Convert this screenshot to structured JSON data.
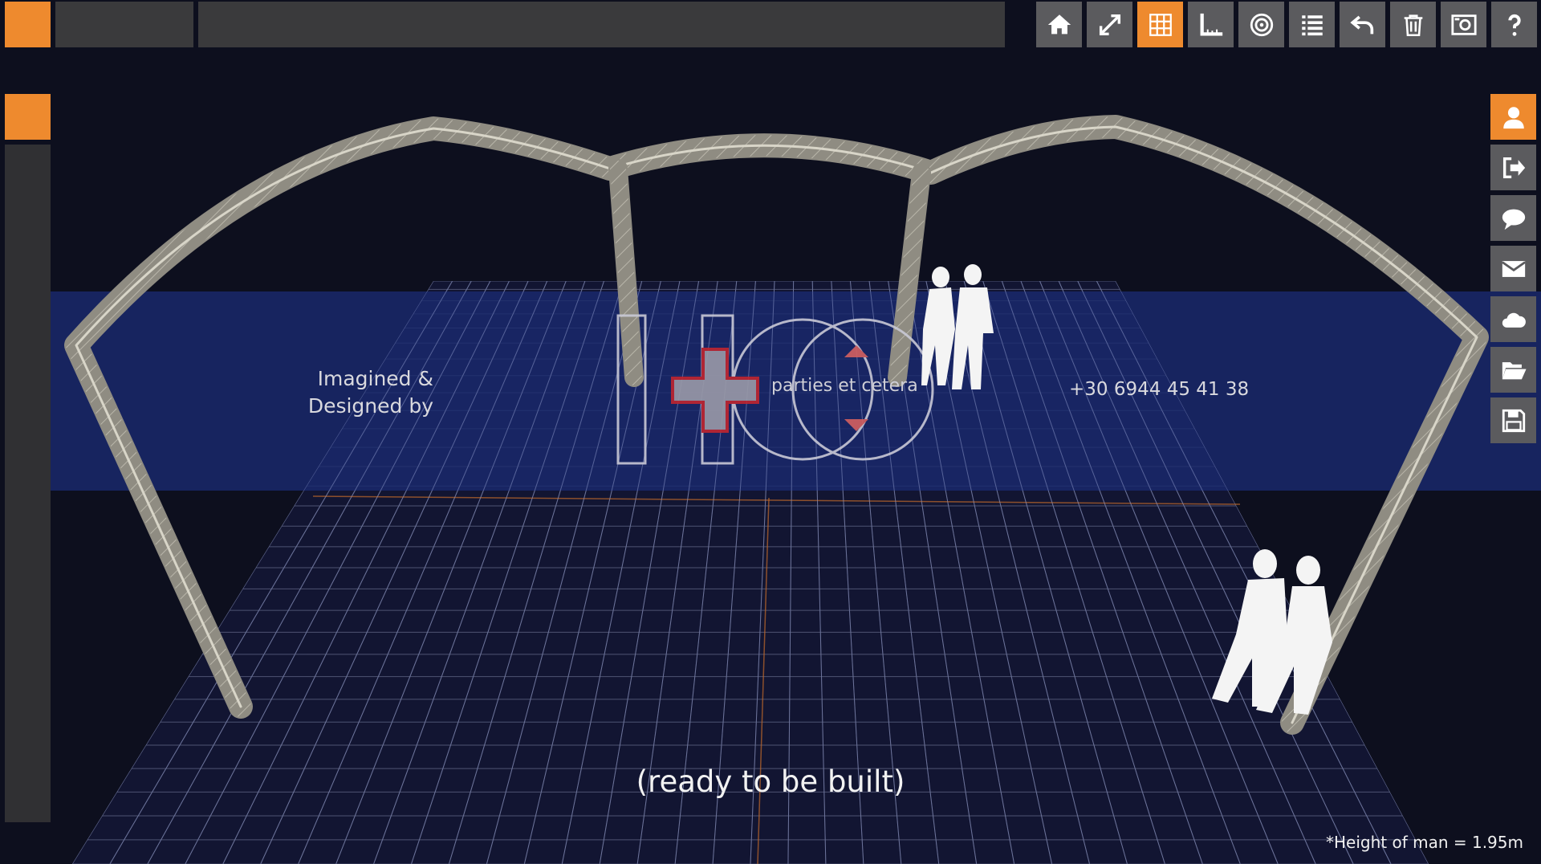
{
  "title_field": "",
  "address_field": "",
  "toolbar": [
    {
      "icon": "home-icon",
      "active": false
    },
    {
      "icon": "expand-icon",
      "active": false
    },
    {
      "icon": "grid-icon",
      "active": true
    },
    {
      "icon": "ruler-icon",
      "active": false
    },
    {
      "icon": "target-icon",
      "active": false
    },
    {
      "icon": "list-icon",
      "active": false
    },
    {
      "icon": "undo-icon",
      "active": false
    },
    {
      "icon": "trash-icon",
      "active": false
    },
    {
      "icon": "camera-icon",
      "active": false
    },
    {
      "icon": "help-icon",
      "active": false
    }
  ],
  "sidebar": [
    {
      "icon": "user-icon",
      "active": true
    },
    {
      "icon": "share-icon",
      "active": false
    },
    {
      "icon": "chat-icon",
      "active": false
    },
    {
      "icon": "mail-icon",
      "active": false
    },
    {
      "icon": "cloud-icon",
      "active": false
    },
    {
      "icon": "folder-open-icon",
      "active": false
    },
    {
      "icon": "save-icon",
      "active": false
    }
  ],
  "colors": {
    "accent": "#ee8a2e",
    "button": "#5b5b5e",
    "background": "#0d0f1e",
    "banner": "#1a2a6e"
  },
  "scene": {
    "imagined_line1": "Imagined &",
    "imagined_line2": "Designed by",
    "brand_text": "parties et cetera",
    "phone": "+30 6944 45 41 38",
    "caption": "(ready to be built)",
    "footnote": "*Height of man = 1.95m"
  }
}
